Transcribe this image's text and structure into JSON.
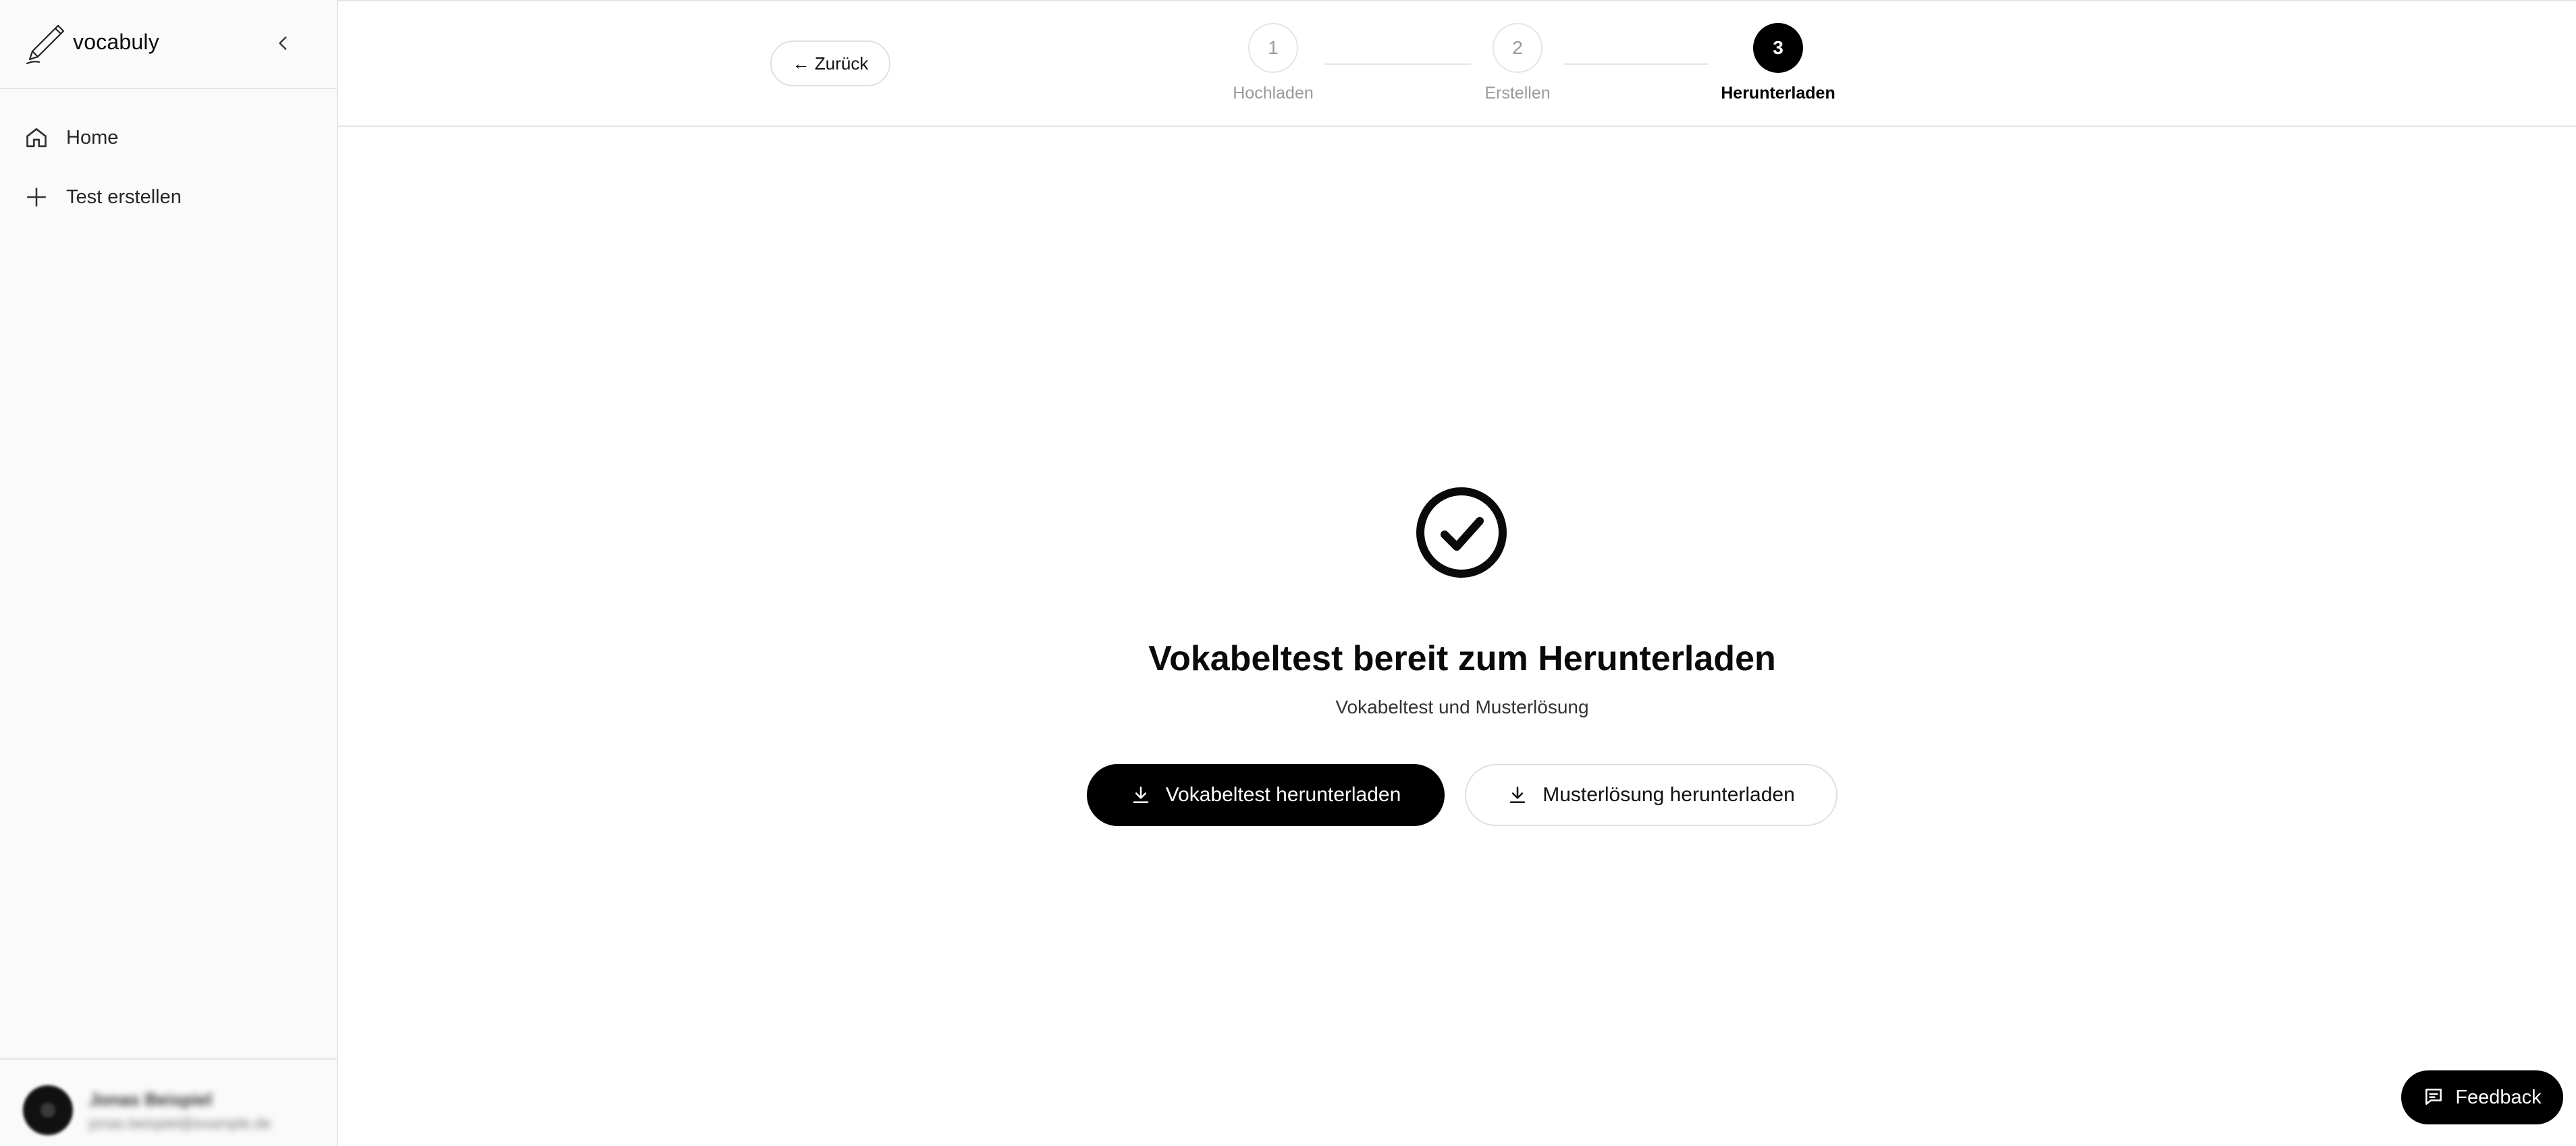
{
  "sidebar": {
    "brand": "vocabuly",
    "nav": [
      {
        "label": "Home",
        "icon": "home-icon"
      },
      {
        "label": "Test erstellen",
        "icon": "plus-icon"
      }
    ],
    "user": {
      "name": "Jonas Beispiel",
      "email": "jonas.beispiel@example.de"
    }
  },
  "topbar": {
    "back_label": "← Zurück",
    "steps": [
      {
        "number": "1",
        "label": "Hochladen",
        "state": "inactive"
      },
      {
        "number": "2",
        "label": "Erstellen",
        "state": "inactive"
      },
      {
        "number": "3",
        "label": "Herunterladen",
        "state": "active"
      }
    ]
  },
  "main": {
    "status_icon": "check-circle-icon",
    "title": "Vokabeltest bereit zum Herunterladen",
    "subtitle": "Vokabeltest und Musterlösung",
    "download_test_label": "Vokabeltest herunterladen",
    "download_solution_label": "Musterlösung herunterladen"
  },
  "feedback": {
    "label": "Feedback"
  },
  "colors": {
    "accent": "#000000",
    "sidebar_bg": "#fafafa",
    "border": "#e5e5e5",
    "muted": "#9a9a9a"
  }
}
